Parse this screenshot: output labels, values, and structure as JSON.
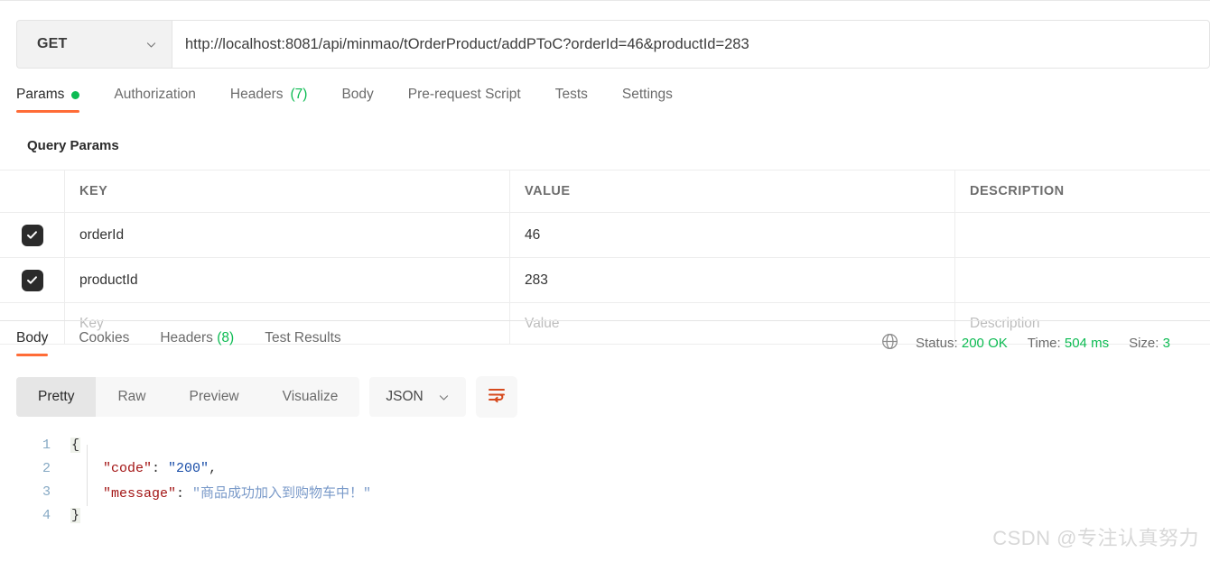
{
  "request": {
    "method": "GET",
    "method_dropdown_icon": "chevron-down-icon",
    "url": "http://localhost:8081/api/minmao/tOrderProduct/addPToC?orderId=46&productId=283",
    "tabs": [
      {
        "label": "Params",
        "badge": "",
        "indicator": "dot",
        "active": true
      },
      {
        "label": "Authorization",
        "badge": "",
        "indicator": "",
        "active": false
      },
      {
        "label": "Headers",
        "badge": "(7)",
        "indicator": "",
        "active": false
      },
      {
        "label": "Body",
        "badge": "",
        "indicator": "",
        "active": false
      },
      {
        "label": "Pre-request Script",
        "badge": "",
        "indicator": "",
        "active": false
      },
      {
        "label": "Tests",
        "badge": "",
        "indicator": "",
        "active": false
      },
      {
        "label": "Settings",
        "badge": "",
        "indicator": "",
        "active": false
      }
    ]
  },
  "query_params": {
    "section_title": "Query Params",
    "columns": [
      "KEY",
      "VALUE",
      "DESCRIPTION"
    ],
    "rows": [
      {
        "checked": true,
        "key": "orderId",
        "value": "46",
        "description": ""
      },
      {
        "checked": true,
        "key": "productId",
        "value": "283",
        "description": ""
      }
    ],
    "placeholder_row": {
      "key": "Key",
      "value": "Value",
      "description": "Description"
    }
  },
  "response": {
    "tabs": [
      {
        "label": "Body",
        "badge": "",
        "active": true
      },
      {
        "label": "Cookies",
        "badge": "",
        "active": false
      },
      {
        "label": "Headers",
        "badge": "(8)",
        "active": false
      },
      {
        "label": "Test Results",
        "badge": "",
        "active": false
      }
    ],
    "status": {
      "globe_icon": "globe-icon",
      "status_label": "Status:",
      "status_value": "200 OK",
      "time_label": "Time:",
      "time_value": "504 ms",
      "size_label": "Size:",
      "size_value": "3"
    },
    "view_modes": [
      {
        "label": "Pretty",
        "active": true
      },
      {
        "label": "Raw",
        "active": false
      },
      {
        "label": "Preview",
        "active": false
      },
      {
        "label": "Visualize",
        "active": false
      }
    ],
    "language": "JSON",
    "language_dropdown_icon": "chevron-down-icon",
    "wrap_button_icon": "word-wrap-icon",
    "body_lines": [
      {
        "num": "1",
        "fold": "{"
      },
      {
        "num": "2",
        "key": "\"code\"",
        "sep": ": ",
        "value": "\"200\"",
        "tail": ","
      },
      {
        "num": "3",
        "key": "\"message\"",
        "sep": ": ",
        "value": "\"商品成功加入到购物车中！\"",
        "tail": ""
      },
      {
        "num": "4",
        "fold": "}"
      }
    ]
  },
  "watermark": {
    "text": "CSDN @专注认真努力"
  },
  "colors": {
    "accent_orange": "#ff6c37",
    "status_green": "#0cbb52",
    "line_number": "#86a9c4"
  }
}
